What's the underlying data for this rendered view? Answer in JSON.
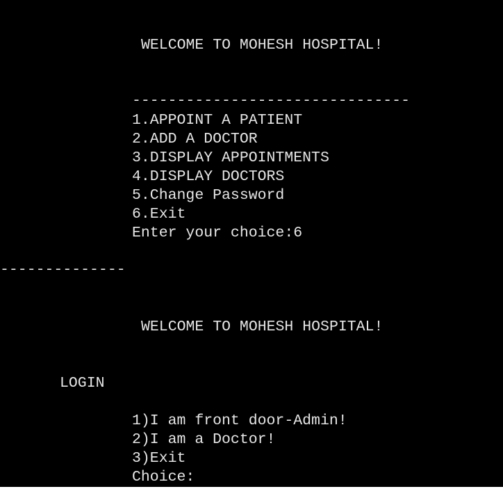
{
  "console": {
    "menu_block": {
      "title": "WELCOME TO MOHESH HOSPITAL!",
      "divider": "-------------------------------",
      "options": [
        "1.APPOINT A PATIENT",
        "2.ADD A DOCTOR",
        "3.DISPLAY APPOINTMENTS",
        "4.DISPLAY DOCTORS",
        "5.Change Password",
        "6.Exit"
      ],
      "prompt": "Enter your choice:6"
    },
    "separator": "--------------",
    "login_block": {
      "title": "WELCOME TO MOHESH HOSPITAL!",
      "heading": "LOGIN",
      "options": [
        "1)I am front door-Admin!",
        "2)I am a Doctor!",
        "3)Exit"
      ],
      "prompt": "Choice:"
    }
  }
}
